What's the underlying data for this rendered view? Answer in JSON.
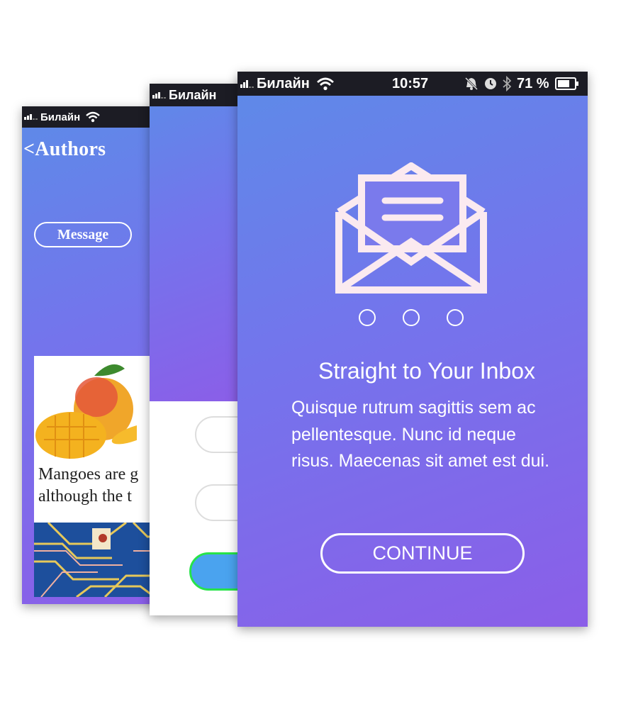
{
  "status": {
    "carrier": "Билайн",
    "time": "10:57",
    "battery": "71 %"
  },
  "screen_authors": {
    "title": "<Authors",
    "message_button": "Message",
    "card_caption_line1": "Mangoes are g",
    "card_caption_line2": "although the t"
  },
  "screen_onboarding": {
    "heading": "Straight to Your Inbox",
    "body_lines": [
      "Quisque rutrum sagittis sem ac",
      "pellentesque.   Nunc id neque",
      "risus. Maecenas sit amet est dui."
    ],
    "continue_button": "CONTINUE",
    "page_dots": 3
  },
  "icons": [
    "signal-icon",
    "wifi-icon",
    "mute-bell-icon",
    "alarm-clock-icon",
    "bluetooth-icon",
    "battery-icon",
    "envelope-icon"
  ],
  "colors": {
    "gradient_start": "#5d8be8",
    "gradient_end": "#8b5ee8",
    "primary_button": "#4aa3ef",
    "button_outline": "#27e34a"
  }
}
